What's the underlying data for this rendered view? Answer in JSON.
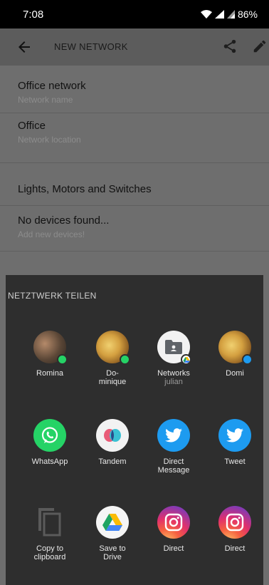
{
  "status": {
    "time": "7:08",
    "battery": "86%"
  },
  "app_bar": {
    "title": "NEW NETWORK",
    "icons": [
      "back-arrow-icon",
      "share-icon",
      "edit-icon"
    ]
  },
  "network": {
    "name_value": "Office network",
    "name_hint": "Network name",
    "location_value": "Office",
    "location_hint": "Network location"
  },
  "devices": {
    "section_title": "Lights, Motors and Switches",
    "empty_title": "No devices found...",
    "empty_hint": "Add new devices!"
  },
  "share_sheet": {
    "title": "NETZTWERK TEILEN",
    "direct_targets": [
      {
        "label": "Romina",
        "badge": "whatsapp-icon"
      },
      {
        "label": "Do-\nminique",
        "badge": "whatsapp-icon"
      },
      {
        "label": "Networks",
        "sub": "julian",
        "badge": "drive-icon"
      },
      {
        "label": "Domi",
        "badge": "twitter-icon"
      }
    ],
    "apps_row1": [
      {
        "label": "WhatsApp",
        "icon": "whatsapp-icon"
      },
      {
        "label": "Tandem",
        "icon": "tandem-icon"
      },
      {
        "label": "Direct\nMessage",
        "icon": "twitter-icon"
      },
      {
        "label": "Tweet",
        "icon": "twitter-icon"
      }
    ],
    "apps_row2": [
      {
        "label": "Copy to\nclipboard",
        "icon": "copy-icon"
      },
      {
        "label": "Save to\nDrive",
        "icon": "drive-icon"
      },
      {
        "label": "Direct",
        "icon": "instagram-icon"
      },
      {
        "label": "Direct",
        "icon": "instagram-icon"
      }
    ]
  }
}
